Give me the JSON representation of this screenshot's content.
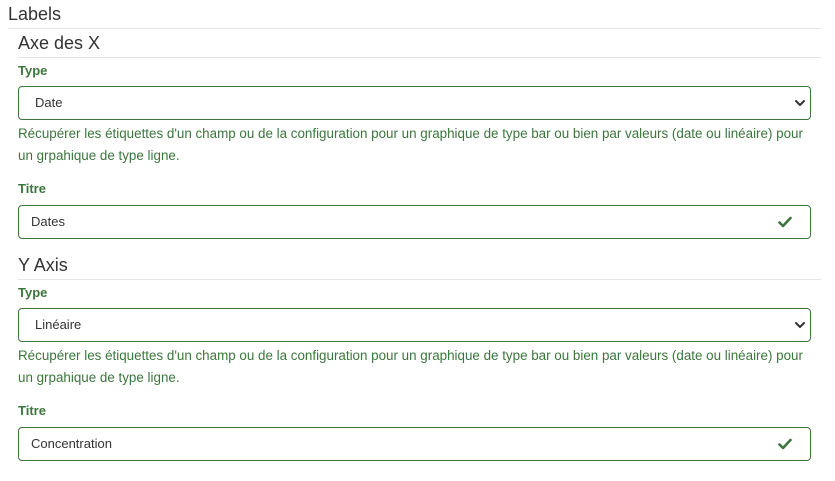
{
  "labels": {
    "title": "Labels"
  },
  "x_axis": {
    "title": "Axe des X",
    "type_label": "Type",
    "type_value": "Date",
    "help": "Récupérer les étiquettes d'un champ ou de la configuration pour un graphique de type bar ou bien par valeurs (date ou linéaire) pour un grpahique de type ligne.",
    "titre_label": "Titre",
    "titre_value": "Dates"
  },
  "y_axis": {
    "title": "Y Axis",
    "type_label": "Type",
    "type_value": "Linéaire",
    "help": "Récupérer les étiquettes d'un champ ou de la configuration pour un graphique de type bar ou bien par valeurs (date ou linéaire) pour un grpahique de type ligne.",
    "titre_label": "Titre",
    "titre_value": "Concentration"
  },
  "colors": {
    "success": "#3c763d",
    "text": "#333333",
    "rule": "#e5e5e5"
  },
  "icons": {
    "dropdown": "chevron-down-icon",
    "valid": "check-icon"
  }
}
